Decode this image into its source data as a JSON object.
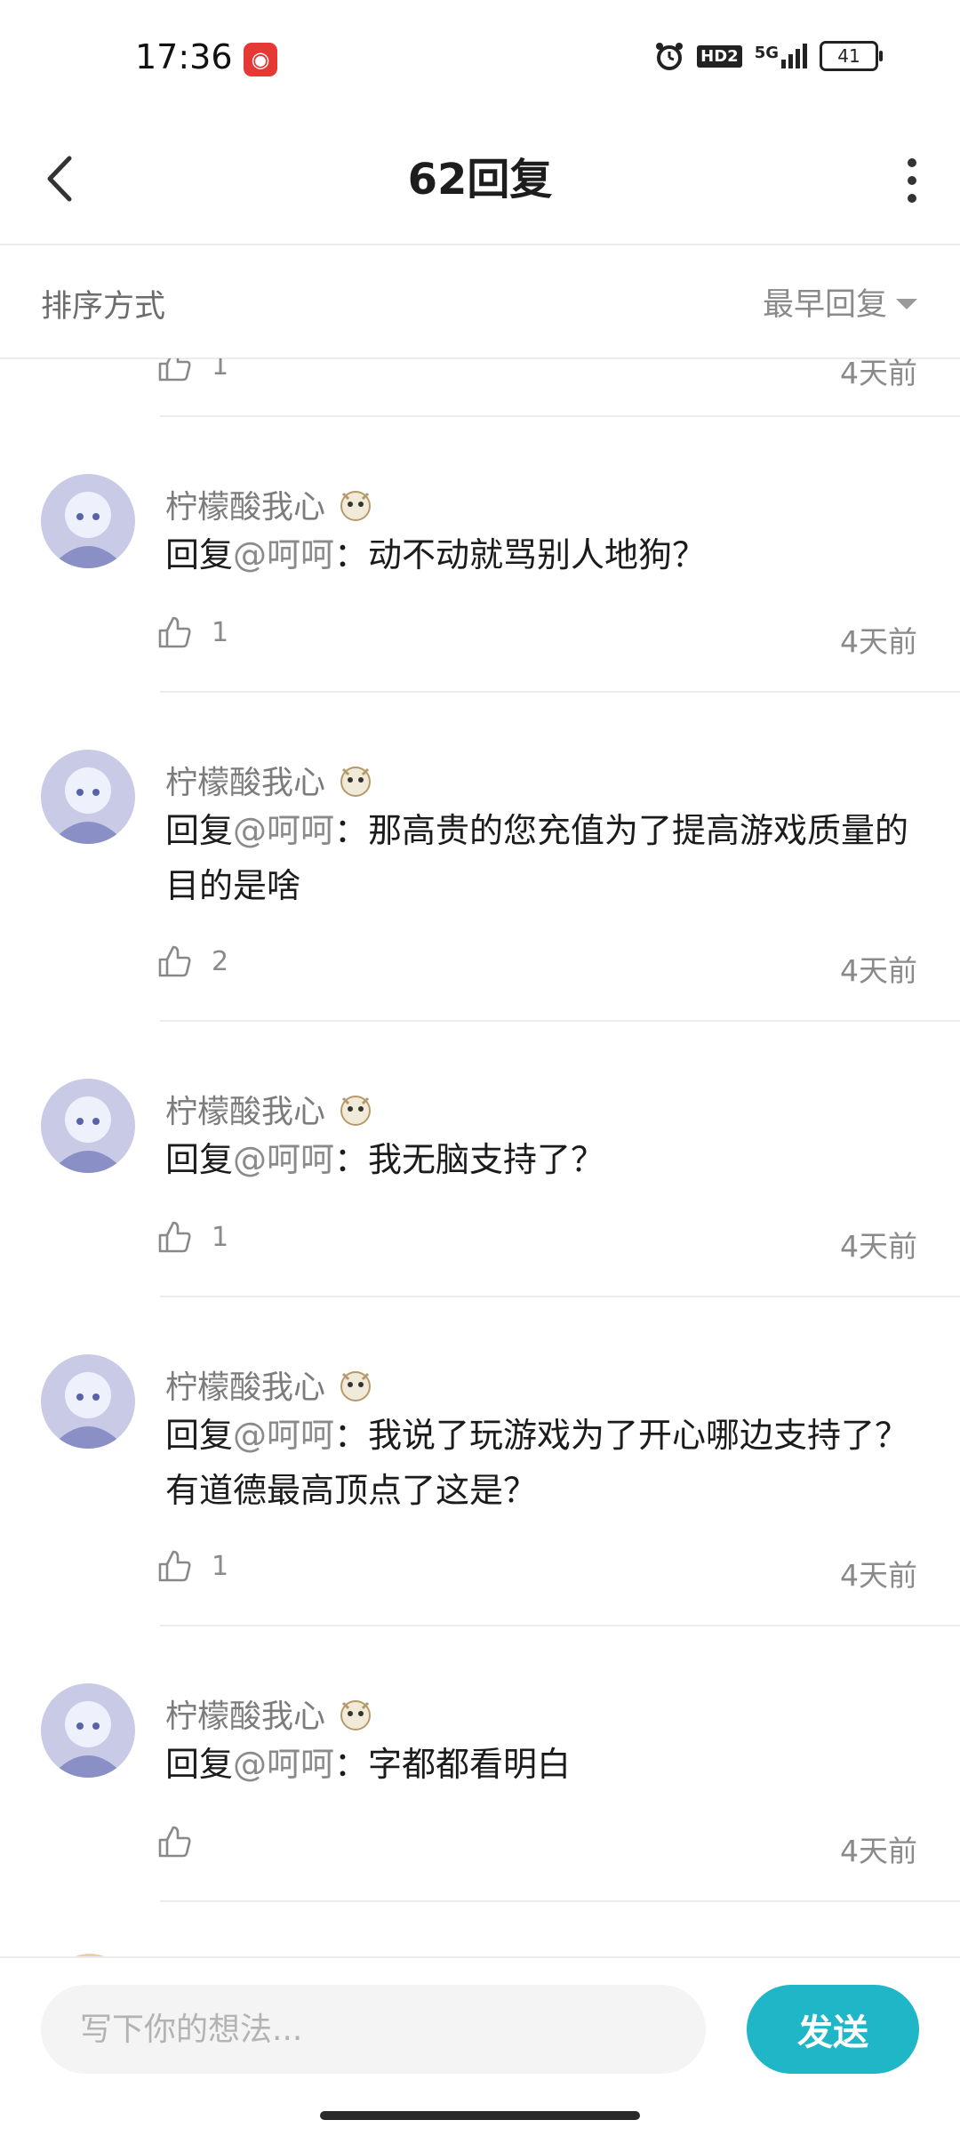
{
  "status_bar": {
    "time": "17:36",
    "app_icon": "netease-music-icon",
    "hd_label": "HD2",
    "network": "5G",
    "battery": "41"
  },
  "header": {
    "title": "62回复",
    "back_icon": "chevron-left-icon",
    "more_icon": "more-vertical-icon"
  },
  "sort": {
    "label": "排序方式",
    "selected": "最早回复"
  },
  "partial_row": {
    "likes": "1",
    "time": "4天前"
  },
  "comments": [
    {
      "username": "柠檬酸我心",
      "reply_prefix": "回复",
      "mention": "@呵呵",
      "colon": "：",
      "text": "动不动就骂别人地狗？",
      "likes": "1",
      "time": "4天前"
    },
    {
      "username": "柠檬酸我心",
      "reply_prefix": "回复",
      "mention": "@呵呵",
      "colon": "：",
      "text": "那高贵的您充值为了提高游戏质量的目的是啥",
      "likes": "2",
      "time": "4天前"
    },
    {
      "username": "柠檬酸我心",
      "reply_prefix": "回复",
      "mention": "@呵呵",
      "colon": "：",
      "text": "我无脑支持了？",
      "likes": "1",
      "time": "4天前"
    },
    {
      "username": "柠檬酸我心",
      "reply_prefix": "回复",
      "mention": "@呵呵",
      "colon": "：",
      "text": "我说了玩游戏为了开心哪边支持了？有道德最高顶点了这是？",
      "likes": "1",
      "time": "4天前"
    },
    {
      "username": "柠檬酸我心",
      "reply_prefix": "回复",
      "mention": "@呵呵",
      "colon": "：",
      "text": "字都都看明白",
      "likes": "",
      "time": "4天前"
    }
  ],
  "composer": {
    "placeholder": "写下你的想法...",
    "send_label": "发送"
  },
  "colors": {
    "accent": "#1fb6c7",
    "muted_text": "#8a8a8a",
    "divider": "#ececec"
  }
}
